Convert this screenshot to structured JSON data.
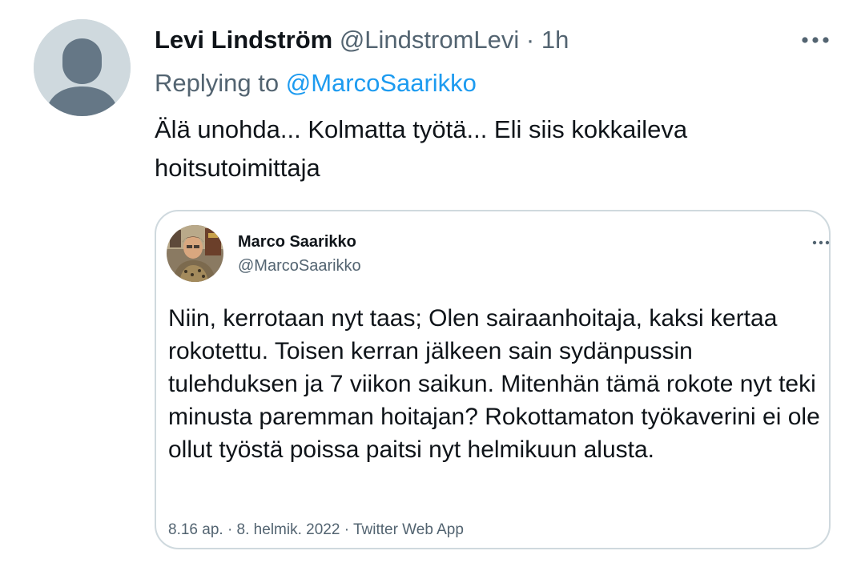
{
  "tweet": {
    "author_name": "Levi Lindström",
    "author_handle": "@LindstromLevi",
    "separator": " · ",
    "time": "1h",
    "more_icon": "more-horizontal-icon",
    "replying_prefix": "Replying to ",
    "replying_mention": "@MarcoSaarikko",
    "text": "Älä unohda... Kolmatta työtä... Eli siis kokkaileva hoitsutoimittaja",
    "avatar_icon": "default-avatar-icon"
  },
  "quoted": {
    "author_name": "Marco Saarikko",
    "author_handle": "@MarcoSaarikko",
    "more_icon": "more-horizontal-icon",
    "text": "Niin, kerrotaan nyt taas; Olen sairaanhoitaja, kaksi kertaa rokotettu. Toisen kerran jälkeen sain sydänpussin tulehduksen ja 7 viikon saikun. Mitenhän tämä rokote nyt teki minusta paremman hoitajan? Rokottamaton työkaverini ei ole ollut työstä poissa paitsi nyt helmikuun alusta.",
    "footer": "8.16 ap. · 8. helmik. 2022 · Twitter Web App"
  },
  "colors": {
    "link": "#1d9bf0",
    "secondary_text": "#536471",
    "primary_text": "#0f1419",
    "border": "#cfd9de"
  }
}
